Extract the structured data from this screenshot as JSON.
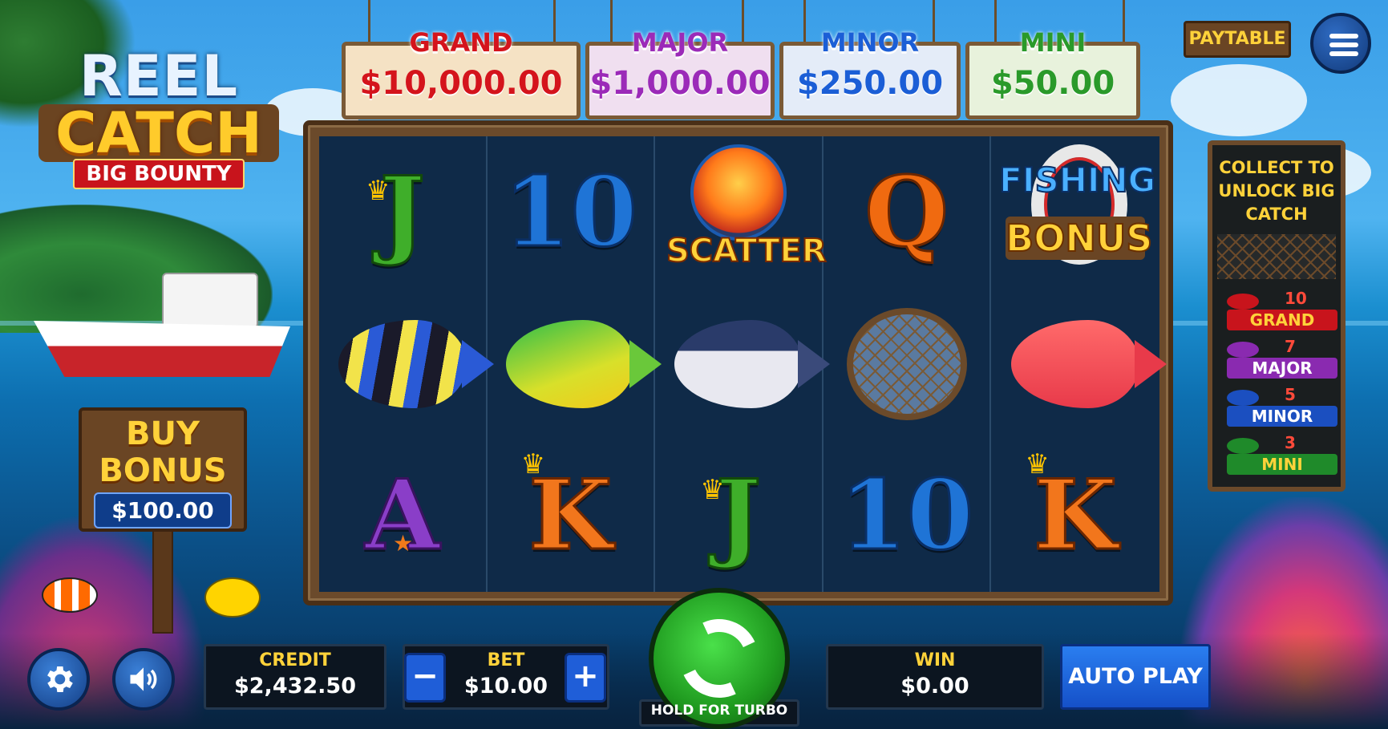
{
  "logo": {
    "line1": "REEL",
    "line2": "CATCH",
    "line3": "BIG BOUNTY"
  },
  "jackpots": [
    {
      "name": "GRAND",
      "amount": "$10,000.00",
      "color": "#d4141c",
      "bg": "#f5e2c4"
    },
    {
      "name": "MAJOR",
      "amount": "$1,000.00",
      "color": "#9b2ab8",
      "bg": "#f0dff0"
    },
    {
      "name": "MINOR",
      "amount": "$250.00",
      "color": "#1b5ed6",
      "bg": "#e4ecf8"
    },
    {
      "name": "MINI",
      "amount": "$50.00",
      "color": "#2a9a2a",
      "bg": "#e8f2dc"
    }
  ],
  "paytable_label": "PAYTABLE",
  "buy_bonus": {
    "label": "BUY BONUS",
    "price": "$100.00"
  },
  "reels": [
    [
      "J",
      "angelfish",
      "A"
    ],
    [
      "10",
      "mahi-mahi",
      "K"
    ],
    [
      "SCATTER",
      "tuna",
      "J"
    ],
    [
      "Q",
      "fishing-net",
      "10"
    ],
    [
      "FISHING BONUS",
      "red-snapper",
      "K"
    ]
  ],
  "symbols": {
    "scatter_label": "SCATTER",
    "fishing_bonus_line1": "FISHING",
    "fishing_bonus_line2": "BONUS"
  },
  "collect": {
    "title": "COLLECT TO UNLOCK BIG CATCH",
    "tiers": [
      {
        "count": "10",
        "name": "GRAND",
        "color": "#c8141c"
      },
      {
        "count": "7",
        "name": "MAJOR",
        "color": "#8a2ab0"
      },
      {
        "count": "5",
        "name": "MINOR",
        "color": "#1b4fc0"
      },
      {
        "count": "3",
        "name": "MINI",
        "color": "#1f8a2a"
      }
    ]
  },
  "bottom_bar": {
    "credit_label": "CREDIT",
    "credit_value": "$2,432.50",
    "bet_label": "BET",
    "bet_value": "$10.00",
    "win_label": "WIN",
    "win_value": "$0.00",
    "spin_hint": "HOLD FOR TURBO",
    "autoplay_label": "AUTO PLAY",
    "decrease": "−",
    "increase": "+"
  },
  "colors": {
    "accent": "#ffd23a",
    "button_blue": "#1f5ed8",
    "spin_green": "#2ec42e"
  }
}
